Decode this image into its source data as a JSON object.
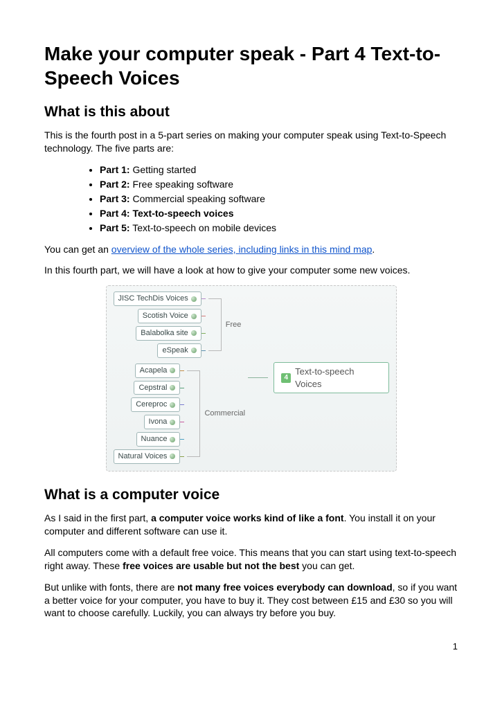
{
  "title": "Make your computer speak - Part 4 Text-to-Speech Voices",
  "section1": {
    "heading": "What is this about",
    "intro": "This is the fourth post in a 5-part series on making your computer speak using Text-to-Speech technology. The five parts are:",
    "parts": [
      {
        "label": "Part 1:",
        "text": " Getting started",
        "bold_text": false
      },
      {
        "label": "Part 2:",
        "text": " Free speaking software",
        "bold_text": false
      },
      {
        "label": "Part 3:",
        "text": " Commercial speaking software",
        "bold_text": false
      },
      {
        "label": "Part 4:",
        "text": " Text-to-speech voices",
        "bold_text": true
      },
      {
        "label": "Part 5:",
        "text": " Text-to-speech on mobile devices",
        "bold_text": false
      }
    ],
    "overview_pre": "You can get an ",
    "overview_link": "overview of the whole series, including links in this mind map",
    "overview_post": ".",
    "para2": "In this fourth part, we will have a look at how to give your computer some new voices."
  },
  "mindmap": {
    "root_badge": "4",
    "root_label": "Text-to-speech Voices",
    "free_label": "Free",
    "commercial_label": "Commercial",
    "free_items": [
      "JISC TechDis Voices",
      "Scotish Voice",
      "Balabolka site",
      "eSpeak"
    ],
    "commercial_items": [
      "Acapela",
      "Cepstral",
      "Cereproc",
      "Ivona",
      "Nuance",
      "Natural Voices"
    ]
  },
  "section2": {
    "heading": "What is a computer voice",
    "p1_pre": "As I said in the first part, ",
    "p1_bold": "a computer voice works kind of like a font",
    "p1_post": ". You install it on your computer and different software can use it.",
    "p2_pre": "All computers come with a default free voice. This means that you can start using text-to-speech right away. These ",
    "p2_bold": "free voices are usable but not the best",
    "p2_post": " you can get.",
    "p3_pre": "But unlike with fonts, there are ",
    "p3_bold": "not many free voices everybody can download",
    "p3_post": ", so if you want a better voice for your computer, you have to buy it. They cost between £15 and £30 so you will want to choose carefully. Luckily, you can always try before you buy."
  },
  "page_number": "1"
}
